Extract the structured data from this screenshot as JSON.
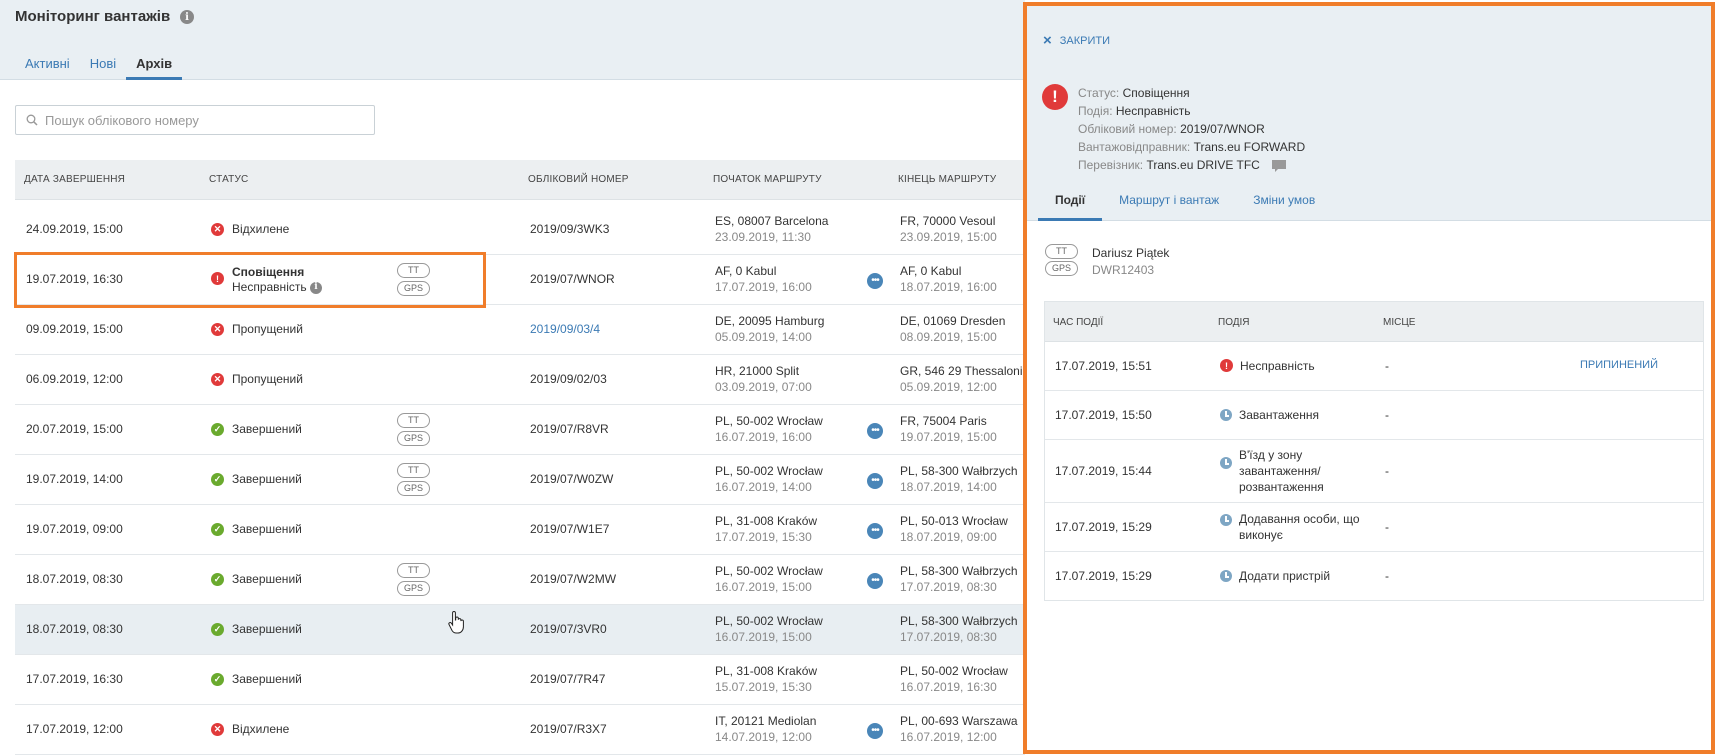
{
  "header": {
    "title": "Моніторинг вантажів",
    "tabs": [
      {
        "label": "Активні"
      },
      {
        "label": "Нові"
      },
      {
        "label": "Архів"
      }
    ]
  },
  "search": {
    "placeholder": "Пошук облікового номеру"
  },
  "table": {
    "columns": [
      "ДАТА ЗАВЕРШЕННЯ",
      "СТАТУС",
      "ОБЛІКОВИЙ НОМЕР",
      "ПОЧАТОК МАРШРУТУ",
      "КІНЕЦЬ МАРШРУТУ"
    ],
    "rows": [
      {
        "date": "24.09.2019, 15:00",
        "status": "Відхилене",
        "status_sub": "",
        "ref": "2019/09/3WK3",
        "start_place": "ES, 08007 Barcelona",
        "start_time": "23.09.2019, 11:30",
        "end_place": "FR, 70000 Vesoul",
        "end_time": "23.09.2019, 15:00"
      },
      {
        "date": "19.07.2019, 16:30",
        "status": "Сповіщення",
        "status_sub": "Несправність",
        "ref": "2019/07/WNOR",
        "start_place": "AF, 0 Kabul",
        "start_time": "17.07.2019, 16:00",
        "end_place": "AF, 0 Kabul",
        "end_time": "18.07.2019, 16:00",
        "badge_tt": "TT",
        "badge_gps": "GPS"
      },
      {
        "date": "09.09.2019, 15:00",
        "status": "Пропущений",
        "status_sub": "",
        "ref": "2019/09/03/4",
        "start_place": "DE, 20095 Hamburg",
        "start_time": "05.09.2019, 14:00",
        "end_place": "DE, 01069 Dresden",
        "end_time": "08.09.2019, 15:00"
      },
      {
        "date": "06.09.2019, 12:00",
        "status": "Пропущений",
        "status_sub": "",
        "ref": "2019/09/02/03",
        "start_place": "HR, 21000 Split",
        "start_time": "03.09.2019, 07:00",
        "end_place": "GR, 546 29 Thessaloni",
        "end_time": "05.09.2019, 12:00"
      },
      {
        "date": "20.07.2019, 15:00",
        "status": "Завершений",
        "status_sub": "",
        "ref": "2019/07/R8VR",
        "start_place": "PL, 50-002 Wrocław",
        "start_time": "16.07.2019, 16:00",
        "end_place": "FR, 75004 Paris",
        "end_time": "19.07.2019, 15:00",
        "badge_tt": "TT",
        "badge_gps": "GPS"
      },
      {
        "date": "19.07.2019, 14:00",
        "status": "Завершений",
        "status_sub": "",
        "ref": "2019/07/W0ZW",
        "start_place": "PL, 50-002 Wrocław",
        "start_time": "16.07.2019, 14:00",
        "end_place": "PL, 58-300 Wałbrzych",
        "end_time": "18.07.2019, 14:00",
        "badge_tt": "TT",
        "badge_gps": "GPS"
      },
      {
        "date": "19.07.2019, 09:00",
        "status": "Завершений",
        "status_sub": "",
        "ref": "2019/07/W1E7",
        "start_place": "PL, 31-008 Kraków",
        "start_time": "17.07.2019, 15:30",
        "end_place": "PL, 50-013 Wrocław",
        "end_time": "18.07.2019, 09:00"
      },
      {
        "date": "18.07.2019, 08:30",
        "status": "Завершений",
        "status_sub": "",
        "ref": "2019/07/W2MW",
        "start_place": "PL, 50-002 Wrocław",
        "start_time": "16.07.2019, 15:00",
        "end_place": "PL, 58-300 Wałbrzych",
        "end_time": "17.07.2019, 08:30",
        "badge_tt": "TT",
        "badge_gps": "GPS"
      },
      {
        "date": "18.07.2019, 08:30",
        "status": "Завершений",
        "status_sub": "",
        "ref": "2019/07/3VR0",
        "start_place": "PL, 50-002 Wrocław",
        "start_time": "16.07.2019, 15:00",
        "end_place": "PL, 58-300 Wałbrzych",
        "end_time": "17.07.2019, 08:30"
      },
      {
        "date": "17.07.2019, 16:30",
        "status": "Завершений",
        "status_sub": "",
        "ref": "2019/07/7R47",
        "start_place": "PL, 31-008 Kraków",
        "start_time": "15.07.2019, 15:30",
        "end_place": "PL, 50-002 Wrocław",
        "end_time": "16.07.2019, 16:30"
      },
      {
        "date": "17.07.2019, 12:00",
        "status": "Відхилене",
        "status_sub": "",
        "ref": "2019/07/R3X7",
        "start_place": "IT, 20121 Mediolan",
        "start_time": "14.07.2019, 12:00",
        "end_place": "PL, 00-693 Warszawa",
        "end_time": "16.07.2019, 12:00"
      }
    ]
  },
  "panel": {
    "close_label": "ЗАКРИТИ",
    "details": [
      {
        "key": "Статус:",
        "value": "Сповіщення"
      },
      {
        "key": "Подія:",
        "value": "Несправність"
      },
      {
        "key": "Обліковий номер:",
        "value": "2019/07/WNOR"
      },
      {
        "key": "Вантажовідправник:",
        "value": "Trans.eu FORWARD"
      },
      {
        "key": "Перевізник:",
        "value": "Trans.eu DRIVE TFC"
      }
    ],
    "tabs": [
      {
        "label": "Події"
      },
      {
        "label": "Маршрут і вантаж"
      },
      {
        "label": "Зміни умов"
      }
    ],
    "driver": {
      "name": "Dariusz Piątek",
      "id": "DWR12403",
      "badge_tt": "TT",
      "badge_gps": "GPS"
    },
    "events_columns": [
      "ЧАС ПОДІЇ",
      "ПОДІЯ",
      "МІСЦЕ"
    ],
    "events": [
      {
        "time": "17.07.2019, 15:51",
        "event": "Несправність",
        "place": "-",
        "action": "ПРИПИНЕНИЙ"
      },
      {
        "time": "17.07.2019, 15:50",
        "event": "Завантаження",
        "place": "-",
        "action": ""
      },
      {
        "time": "17.07.2019, 15:44",
        "event": "В'їзд у зону завантаження/ розвантаження",
        "place": "-",
        "action": ""
      },
      {
        "time": "17.07.2019, 15:29",
        "event": "Додавання особи, що виконує",
        "place": "-",
        "action": ""
      },
      {
        "time": "17.07.2019, 15:29",
        "event": "Додати пристрій",
        "place": "-",
        "action": ""
      }
    ]
  },
  "colors": {
    "accent": "#3b7ab4",
    "highlight": "#f07d2a",
    "error": "#e03a3a",
    "success": "#6aaa2e"
  }
}
